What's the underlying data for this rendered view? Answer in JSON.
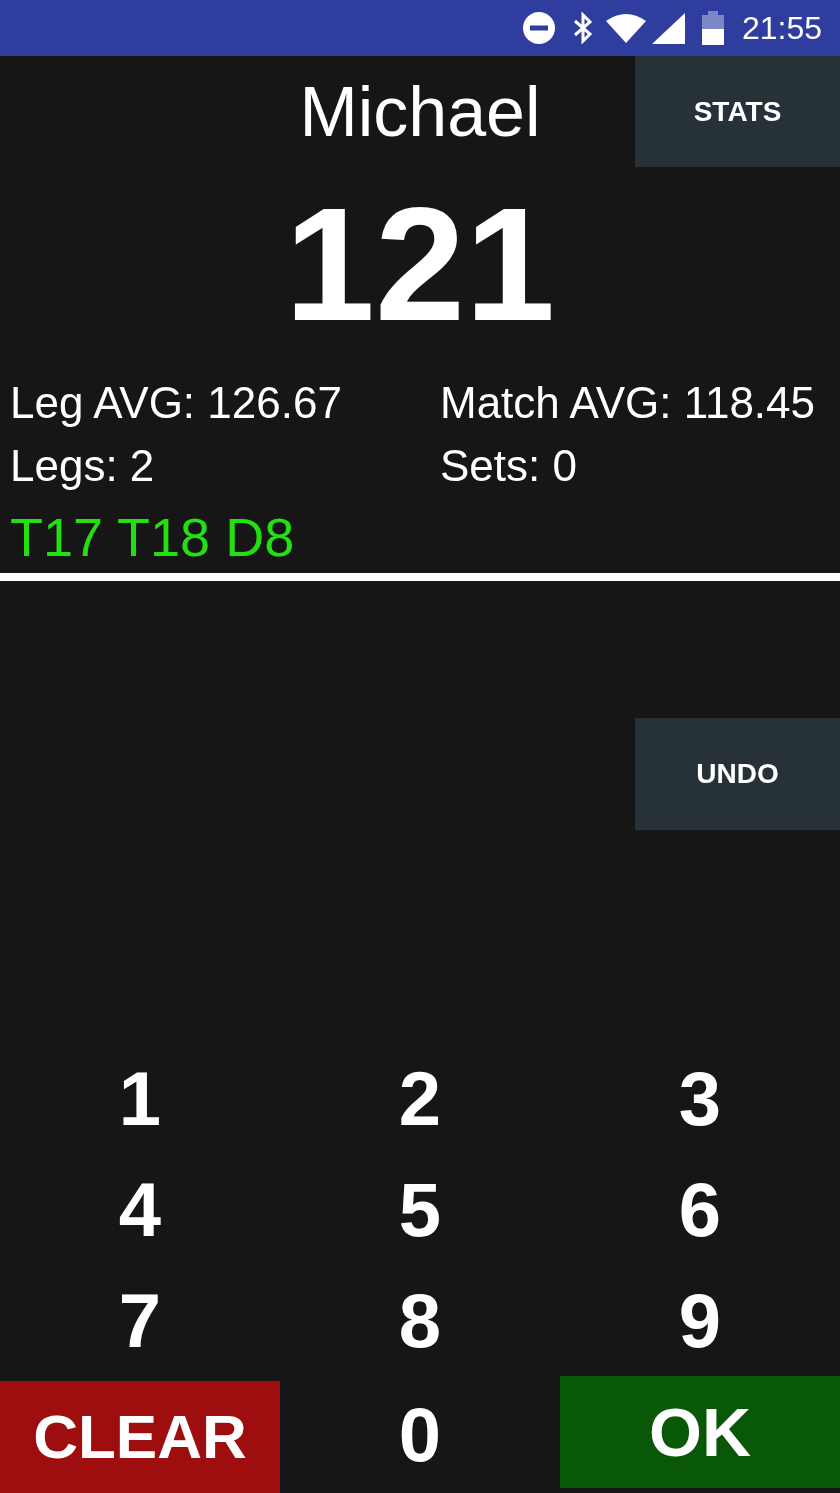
{
  "status_bar": {
    "time": "21:55"
  },
  "player": {
    "name": "Michael",
    "score": "121"
  },
  "stats_button": {
    "label": "STATS"
  },
  "stats": [
    "Leg AVG: 126.67",
    "Match AVG: 118.45",
    "Legs: 2",
    "Sets: 0"
  ],
  "checkout": "T17 T18 D8",
  "undo_button": {
    "label": "UNDO"
  },
  "keypad": [
    {
      "label": "1",
      "kind": "digit"
    },
    {
      "label": "2",
      "kind": "digit"
    },
    {
      "label": "3",
      "kind": "digit"
    },
    {
      "label": "4",
      "kind": "digit"
    },
    {
      "label": "5",
      "kind": "digit"
    },
    {
      "label": "6",
      "kind": "digit"
    },
    {
      "label": "7",
      "kind": "digit"
    },
    {
      "label": "8",
      "kind": "digit"
    },
    {
      "label": "9",
      "kind": "digit"
    },
    {
      "label": "CLEAR",
      "kind": "clear"
    },
    {
      "label": "0",
      "kind": "digit"
    },
    {
      "label": "OK",
      "kind": "confirm"
    }
  ]
}
